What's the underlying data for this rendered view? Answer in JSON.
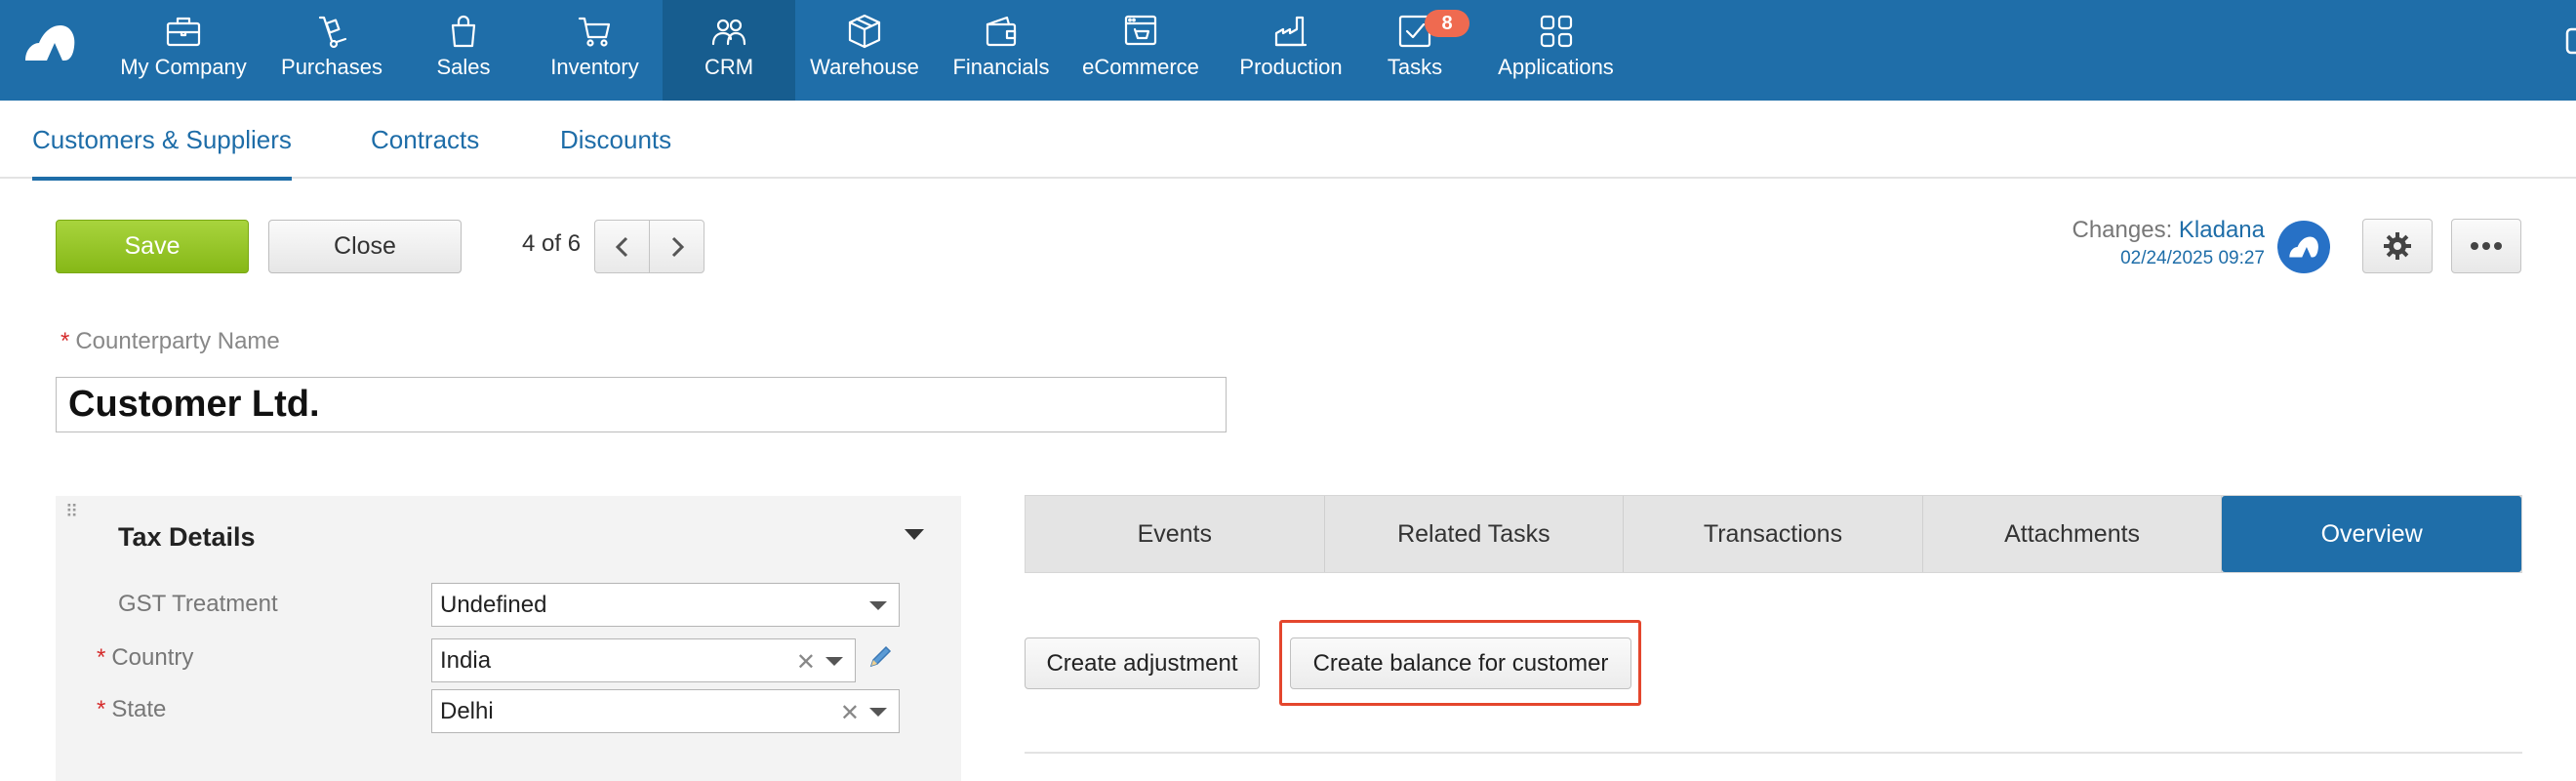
{
  "nav": {
    "items": [
      {
        "label": "My Company",
        "icon": "briefcase-icon"
      },
      {
        "label": "Purchases",
        "icon": "hand-truck-icon"
      },
      {
        "label": "Sales",
        "icon": "shopping-bag-icon"
      },
      {
        "label": "Inventory",
        "icon": "cart-icon"
      },
      {
        "label": "CRM",
        "icon": "people-icon"
      },
      {
        "label": "Warehouse",
        "icon": "box-icon"
      },
      {
        "label": "Financials",
        "icon": "wallet-icon"
      },
      {
        "label": "eCommerce",
        "icon": "storefront-icon"
      },
      {
        "label": "Production",
        "icon": "factory-icon"
      },
      {
        "label": "Tasks",
        "icon": "checkbox-icon"
      },
      {
        "label": "Applications",
        "icon": "apps-grid-icon"
      }
    ],
    "active": "CRM",
    "tasks_badge": "8"
  },
  "subnav": {
    "tabs": [
      {
        "label": "Customers & Suppliers"
      },
      {
        "label": "Contracts"
      },
      {
        "label": "Discounts"
      }
    ],
    "active": "Customers & Suppliers"
  },
  "toolbar": {
    "save_label": "Save",
    "close_label": "Close",
    "pager_text": "4 of 6"
  },
  "changes": {
    "label": "Changes:",
    "user": "Kladana",
    "timestamp": "02/24/2025 09:27"
  },
  "form": {
    "name_label": "Counterparty Name",
    "name_value": "Customer Ltd.",
    "required_mark": "*"
  },
  "tax_panel": {
    "title": "Tax Details",
    "fields": [
      {
        "label": "GST Treatment",
        "value": "Undefined"
      },
      {
        "label": "Country",
        "value": "India"
      },
      {
        "label": "State",
        "value": "Delhi"
      }
    ]
  },
  "detail_tabs": {
    "tabs": [
      {
        "label": "Events"
      },
      {
        "label": "Related Tasks"
      },
      {
        "label": "Transactions"
      },
      {
        "label": "Attachments"
      },
      {
        "label": "Overview"
      }
    ],
    "active": "Overview"
  },
  "actions": {
    "create_adjustment": "Create adjustment",
    "create_balance": "Create balance for customer"
  },
  "colors": {
    "topbar": "#1f6ea9",
    "accent": "#1e6da8",
    "save_green": "#8cc11f",
    "badge": "#ef6a50",
    "highlight": "#e4462d"
  }
}
